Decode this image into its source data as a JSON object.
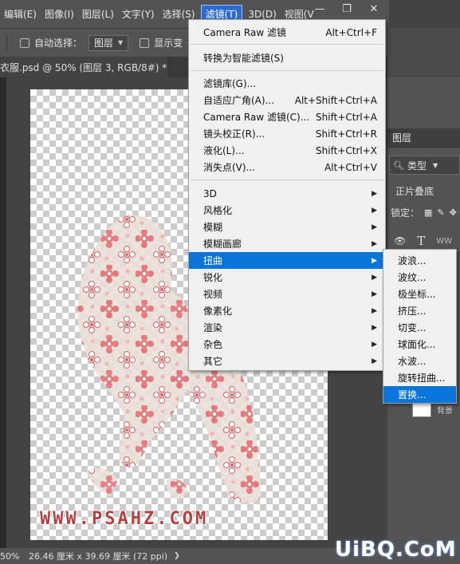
{
  "menubar": {
    "items": [
      {
        "label": "编辑(E)"
      },
      {
        "label": "图像(I)"
      },
      {
        "label": "图层(L)"
      },
      {
        "label": "文字(Y)"
      },
      {
        "label": "选择(S)"
      },
      {
        "label": "滤镜(T)",
        "active": true
      },
      {
        "label": "3D(D)"
      },
      {
        "label": "视图(V"
      }
    ],
    "window_controls": {
      "minimize": "—",
      "restore": "❐",
      "close": "✕"
    }
  },
  "options_bar": {
    "auto_select_label": "自动选择：",
    "auto_select_target": "图层",
    "show_transform_label": "显示变"
  },
  "document_tab": {
    "title": "衣服.psd @ 50% (图层 3, RGB/8#) *",
    "close": "×"
  },
  "layers_panel": {
    "title": "图层",
    "kind_filter": "类型",
    "blend_mode": "正片叠底",
    "lock_label": "锁定：",
    "text_layer_name": "WW",
    "background_label": "背景"
  },
  "filter_menu": {
    "items": [
      {
        "label": "Camera Raw 滤镜",
        "shortcut": "Alt+Ctrl+F"
      },
      {
        "divider": true
      },
      {
        "label": "转换为智能滤镜(S)",
        "shortcut": ""
      },
      {
        "divider": true
      },
      {
        "label": "滤镜库(G)...",
        "shortcut": ""
      },
      {
        "label": "自适应广角(A)...",
        "shortcut": "Alt+Shift+Ctrl+A"
      },
      {
        "label": "Camera Raw 滤镜(C)...",
        "shortcut": "Shift+Ctrl+A"
      },
      {
        "label": "镜头校正(R)...",
        "shortcut": "Shift+Ctrl+R"
      },
      {
        "label": "液化(L)...",
        "shortcut": "Shift+Ctrl+X"
      },
      {
        "label": "消失点(V)...",
        "shortcut": "Alt+Ctrl+V"
      },
      {
        "divider": true
      },
      {
        "label": "3D",
        "submenu": true
      },
      {
        "label": "风格化",
        "submenu": true
      },
      {
        "label": "模糊",
        "submenu": true
      },
      {
        "label": "模糊画廊",
        "submenu": true
      },
      {
        "label": "扭曲",
        "submenu": true,
        "highlighted": true
      },
      {
        "label": "锐化",
        "submenu": true
      },
      {
        "label": "视频",
        "submenu": true
      },
      {
        "label": "像素化",
        "submenu": true
      },
      {
        "label": "渲染",
        "submenu": true
      },
      {
        "label": "杂色",
        "submenu": true
      },
      {
        "label": "其它",
        "submenu": true
      }
    ]
  },
  "distort_submenu": {
    "items": [
      {
        "label": "波浪..."
      },
      {
        "label": "波纹..."
      },
      {
        "label": "极坐标..."
      },
      {
        "label": "挤压..."
      },
      {
        "label": "切变..."
      },
      {
        "label": "球面化..."
      },
      {
        "label": "水波..."
      },
      {
        "label": "旋转扭曲..."
      },
      {
        "label": "置换...",
        "highlighted": true
      }
    ]
  },
  "status_bar": {
    "zoom": "50%",
    "dimensions": "26.46 厘米 x 39.69 厘米 (72 ppi)"
  },
  "watermark": "WWW.PSAHZ.COM",
  "corner_logo": "UiBQ.CoM",
  "colors": {
    "accent": "#0a74da",
    "menu_bg": "#f0f0f0",
    "panel_bg": "#535353",
    "print_red": "#d9696b"
  }
}
